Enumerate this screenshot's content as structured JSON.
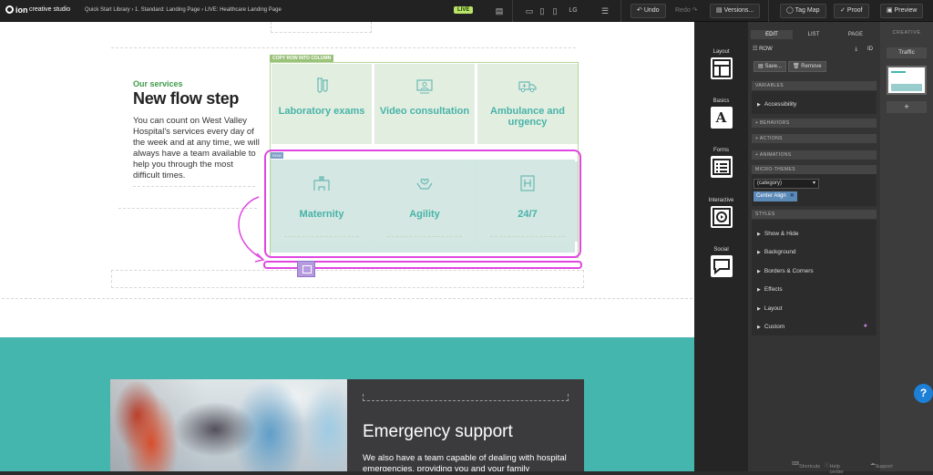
{
  "topbar": {
    "logo": "ion",
    "brand": "creative studio",
    "breadcrumb": "Quick Start Library › 1. Standard: Landing Page › LIVE: Healthcare Landing Page",
    "live_badge": "LIVE",
    "device_label": "LG",
    "undo": "Undo",
    "redo": "Redo",
    "versions": "Versions...",
    "tag_map": "Tag Map",
    "proof": "Proof",
    "preview": "Preview"
  },
  "canvas": {
    "eyebrow": "Our services",
    "heading": "New flow step",
    "description": "You can count on West Valley Hospital's services every day of the week and at any time, we will always have a team available to help you through the most difficult times.",
    "copy_label": "COPY ROW INTO COLUMN",
    "row_label": "ROW",
    "cards_row1": [
      {
        "label": "Laboratory exams",
        "icon": "test-tubes-icon"
      },
      {
        "label": "Video consultation",
        "icon": "video-consult-icon"
      },
      {
        "label": "Ambulance and urgency",
        "icon": "ambulance-icon"
      }
    ],
    "cards_row2": [
      {
        "label": "Maternity",
        "icon": "hospital-icon"
      },
      {
        "label": "Agility",
        "icon": "hands-heart-icon"
      },
      {
        "label": "24/7",
        "icon": "h-sign-icon"
      }
    ],
    "emergency": {
      "title": "Emergency support",
      "body": "We also have a team capable of dealing with hospital emergencies, providing you and your family"
    },
    "colors": {
      "teal": "#45b6ae",
      "accent_green": "#3d9c49",
      "card_text": "#48b3a8",
      "selection": "#e046e0"
    }
  },
  "toolbox": {
    "items": [
      {
        "label": "Layout",
        "icon": "layout-icon"
      },
      {
        "label": "Basics",
        "icon": "text-a-icon"
      },
      {
        "label": "Forms",
        "icon": "form-icon"
      },
      {
        "label": "Interactive",
        "icon": "play-icon"
      },
      {
        "label": "Social",
        "icon": "chat-bubble-icon"
      }
    ]
  },
  "panel": {
    "tabs": [
      "EDIT",
      "LIST",
      "PAGE"
    ],
    "element": "ROW",
    "save": "Save...",
    "remove": "Remove",
    "variables_head": "VARIABLES",
    "accessibility": "Accessibility",
    "behaviors": "+ BEHAVIORS",
    "actions": "+ ACTIONS",
    "animations": "+ ANIMATIONS",
    "micro_themes_head": "MICRO-THEMES",
    "category_select": "(category)",
    "chip": "Center Align",
    "styles_head": "STYLES",
    "styles": [
      "Show & Hide",
      "Background",
      "Borders & Corners",
      "Effects",
      "Layout",
      "Custom"
    ],
    "footer": [
      "Shortcuts",
      "Help center",
      "Support"
    ]
  },
  "rightbar": {
    "head": "CREATIVE",
    "traffic": "Traffic",
    "add": "+"
  },
  "help": "?"
}
